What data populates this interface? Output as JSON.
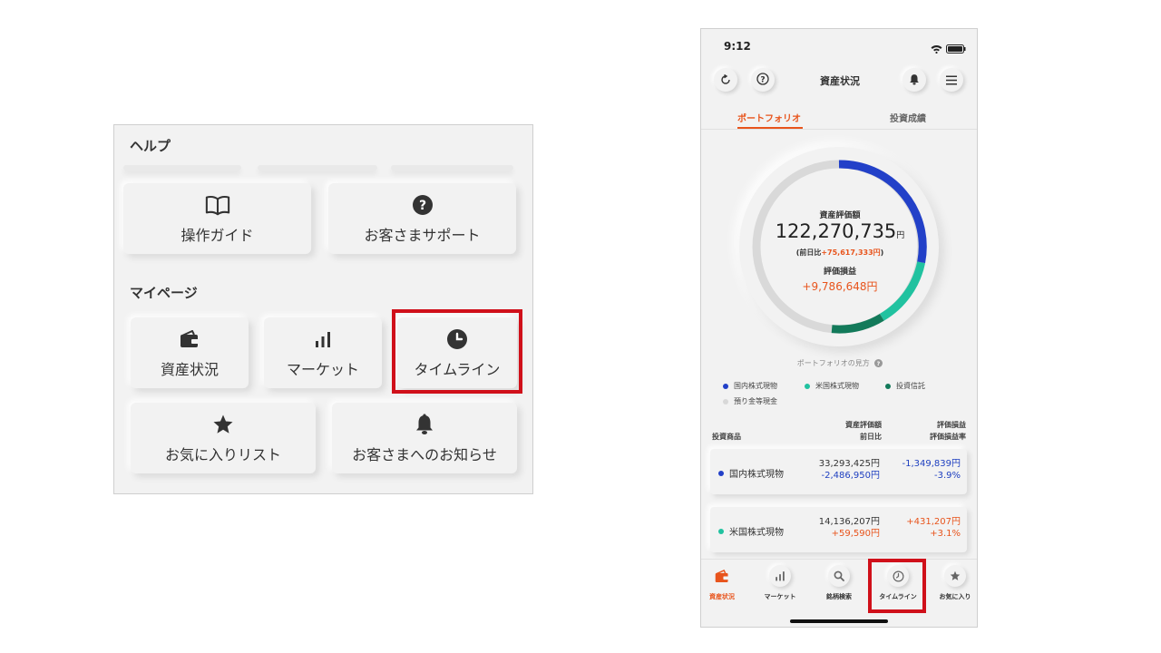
{
  "left_panel": {
    "help_title": "ヘルプ",
    "help_tiles": [
      {
        "label": "操作ガイド",
        "icon": "book-icon"
      },
      {
        "label": "お客さまサポート",
        "icon": "question-circle-icon"
      }
    ],
    "mypage_title": "マイページ",
    "mypage_tiles": [
      {
        "label": "資産状況",
        "icon": "wallet-icon"
      },
      {
        "label": "マーケット",
        "icon": "bar-chart-icon"
      },
      {
        "label": "タイムライン",
        "icon": "clock-icon"
      },
      {
        "label": "お気に入りリスト",
        "icon": "star-icon"
      },
      {
        "label": "お客さまへのお知らせ",
        "icon": "bell-icon"
      }
    ]
  },
  "phone": {
    "status_time": "9:12",
    "header_title": "資産状況",
    "tabs": [
      {
        "label": "ポートフォリオ",
        "active": true
      },
      {
        "label": "投資成績",
        "active": false
      }
    ],
    "summary": {
      "total_label": "資産評価額",
      "total_value": "122,270,735",
      "total_unit": "円",
      "prev_prefix": "(前日比",
      "prev_value": "+75,617,333円",
      "prev_suffix": ")",
      "pl_label": "評価損益",
      "pl_value": "+9,786,648円"
    },
    "legend_title": "ポートフォリオの見方",
    "legend": [
      {
        "label": "国内株式現物",
        "color": "#2240c8"
      },
      {
        "label": "米国株式現物",
        "color": "#21c2a0"
      },
      {
        "label": "投資信託",
        "color": "#137a5a"
      },
      {
        "label": "預り金等現金",
        "color": "#d8d8d8"
      }
    ],
    "table_headers": {
      "product": "投資商品",
      "value_line1": "資産評価額",
      "value_line2": "前日比",
      "pl_line1": "評価損益",
      "pl_line2": "評価損益率"
    },
    "holdings": [
      {
        "name": "国内株式現物",
        "color": "#2240c8",
        "value": "33,293,425円",
        "day_change": "-2,486,950円",
        "pl": "-1,349,839円",
        "pl_rate": "-3.9%"
      },
      {
        "name": "米国株式現物",
        "color": "#21c2a0",
        "value": "14,136,207円",
        "day_change": "+59,590円",
        "pl": "+431,207円",
        "pl_rate": "+3.1%"
      }
    ],
    "nav": [
      {
        "label": "資産状況",
        "icon": "wallet-icon",
        "active": true
      },
      {
        "label": "マーケット",
        "icon": "bar-chart-icon",
        "active": false
      },
      {
        "label": "銘柄検索",
        "icon": "search-icon",
        "active": false
      },
      {
        "label": "タイムライン",
        "icon": "clock-icon",
        "active": false
      },
      {
        "label": "お気に入り",
        "icon": "star-icon",
        "active": false
      }
    ],
    "colors": {
      "accent": "#e8541c",
      "negative": "#1e3fc0",
      "highlight": "#d0101a"
    }
  }
}
